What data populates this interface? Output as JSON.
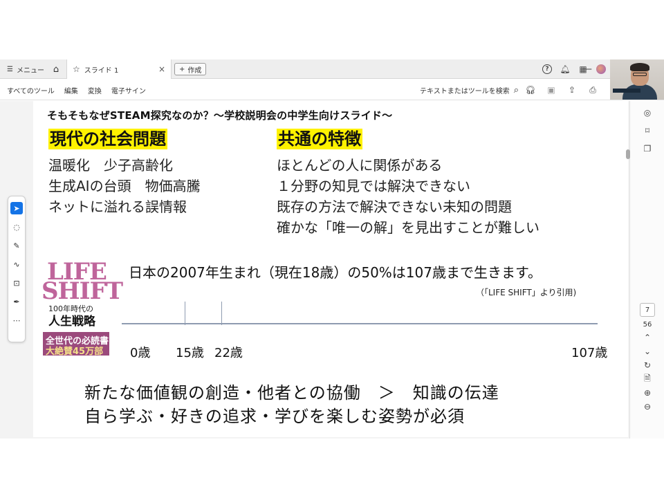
{
  "tabbar": {
    "menu_label": "メニュー",
    "tab_title": "スライド 1",
    "new_label": "作成"
  },
  "toolbar": {
    "menu_items": [
      "すべてのツール",
      "編集",
      "変換",
      "電子サイン"
    ],
    "search_placeholder": "テキストまたはツールを検索"
  },
  "slide": {
    "title": "そもそもなぜSTEAM探究なのか？～学校説明会の中学生向けスライド～",
    "left_heading": "現代の社会問題",
    "left_items": [
      "温暖化　少子高齢化",
      "生成AIの台頭　物価高騰",
      "ネットに溢れる誤情報"
    ],
    "right_heading": "共通の特徴",
    "right_items": [
      "ほとんどの人に関係がある",
      "１分野の知見では解決できない",
      "既存の方法で解決できない未知の問題",
      "確かな「唯一の解」を見出すことが難しい"
    ],
    "book": {
      "line1": "LIFE",
      "line2": "SHIFT",
      "sub": "100年時代の",
      "main": "人生戦略",
      "band1": "全世代の必読書",
      "band2": "大絶賛45万部"
    },
    "statement": "日本の2007年生まれ（現在18歳）の50%は107歳まで生きます。",
    "citation": "（「LIFE SHIFT」より引用)",
    "ages": [
      "0歳",
      "15歳",
      "22歳",
      "107歳"
    ],
    "bottom_line1": "新たな価値観の創造・他者との協働　＞　知識の伝達",
    "bottom_line2": "自ら学ぶ・好きの追求・学びを楽しむ姿勢が必須"
  },
  "right_panel": {
    "page_current": "7",
    "page_total": "56"
  }
}
